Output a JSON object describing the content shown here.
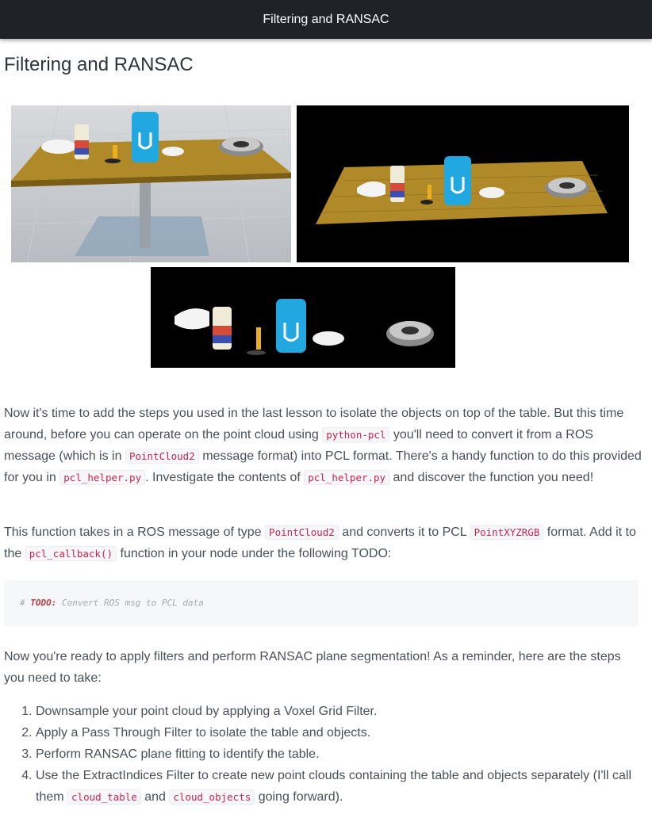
{
  "header": {
    "title": "Filtering and RANSAC"
  },
  "page": {
    "title": "Filtering and RANSAC"
  },
  "figures": [
    {
      "name": "gazebo-scene-image",
      "icon": "simulation-scene"
    },
    {
      "name": "point-cloud-scene-image",
      "icon": "point-cloud"
    },
    {
      "name": "filtered-objects-image",
      "icon": "point-cloud-objects"
    }
  ],
  "para1": {
    "t1": "Now it's time to add the steps you used in the last lesson to isolate the objects on top of the table. But this time around, before you can operate on the point cloud using ",
    "c1": "python-pcl",
    "t2": " you'll need to convert it from a ROS message (which is in ",
    "c2": "PointCloud2",
    "t3": " message format) into PCL format. There's a handy function to do this provided for you in ",
    "c3": "pcl_helper.py",
    "t4": ". Investigate the contents of ",
    "c4": "pcl_helper.py",
    "t5": " and discover the function you need!"
  },
  "para2": {
    "t1": "This function takes in a ROS message of type ",
    "c1": "PointCloud2",
    "t2": " and converts it to PCL ",
    "c2": "PointXYZRGB",
    "t3": " format. Add it to the ",
    "c3": "pcl_callback()",
    "t4": " function in your node under the following TODO:"
  },
  "code": {
    "hash": "# ",
    "keyword": "TODO:",
    "rest": " Convert ROS msg to PCL data"
  },
  "para3": {
    "text": "Now you're ready to apply filters and perform RANSAC plane segmentation! As a reminder, here are the steps you need to take:"
  },
  "steps": [
    {
      "text": "Downsample your point cloud by applying a Voxel Grid Filter."
    },
    {
      "text": "Apply a Pass Through Filter to isolate the table and objects."
    },
    {
      "text": "Perform RANSAC plane fitting to identify the table."
    },
    {
      "t1": "Use the ExtractIndices Filter to create new point clouds containing the table and objects separately (I'll call them ",
      "c1": "cloud_table",
      "t2": " and ",
      "c2": "cloud_objects",
      "t3": " going forward)."
    }
  ],
  "colors": {
    "header_bg": "#1f2328",
    "code_text": "#c7254e",
    "table_wood": "#b08a28",
    "can_blue": "#22a8e0"
  }
}
